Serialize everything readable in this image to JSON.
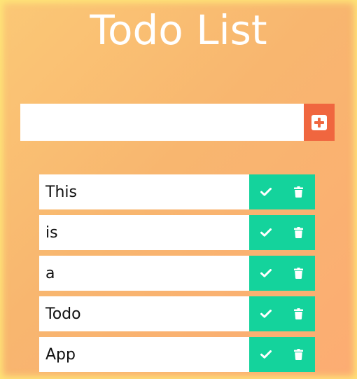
{
  "app": {
    "title": "Todo List"
  },
  "form": {
    "input_value": "",
    "input_placeholder": "",
    "add_icon": "plus-square-icon"
  },
  "todos": [
    {
      "text": "This",
      "complete_icon": "check-icon",
      "delete_icon": "trash-icon"
    },
    {
      "text": "is",
      "complete_icon": "check-icon",
      "delete_icon": "trash-icon"
    },
    {
      "text": "a",
      "complete_icon": "check-icon",
      "delete_icon": "trash-icon"
    },
    {
      "text": "Todo",
      "complete_icon": "check-icon",
      "delete_icon": "trash-icon"
    },
    {
      "text": "App",
      "complete_icon": "check-icon",
      "delete_icon": "trash-icon"
    }
  ],
  "colors": {
    "background_start": "#fbc876",
    "background_end": "#fcac73",
    "add_button": "#f0663f",
    "action_bar": "#14d39c",
    "text": "#111111",
    "title": "#ffffff"
  }
}
